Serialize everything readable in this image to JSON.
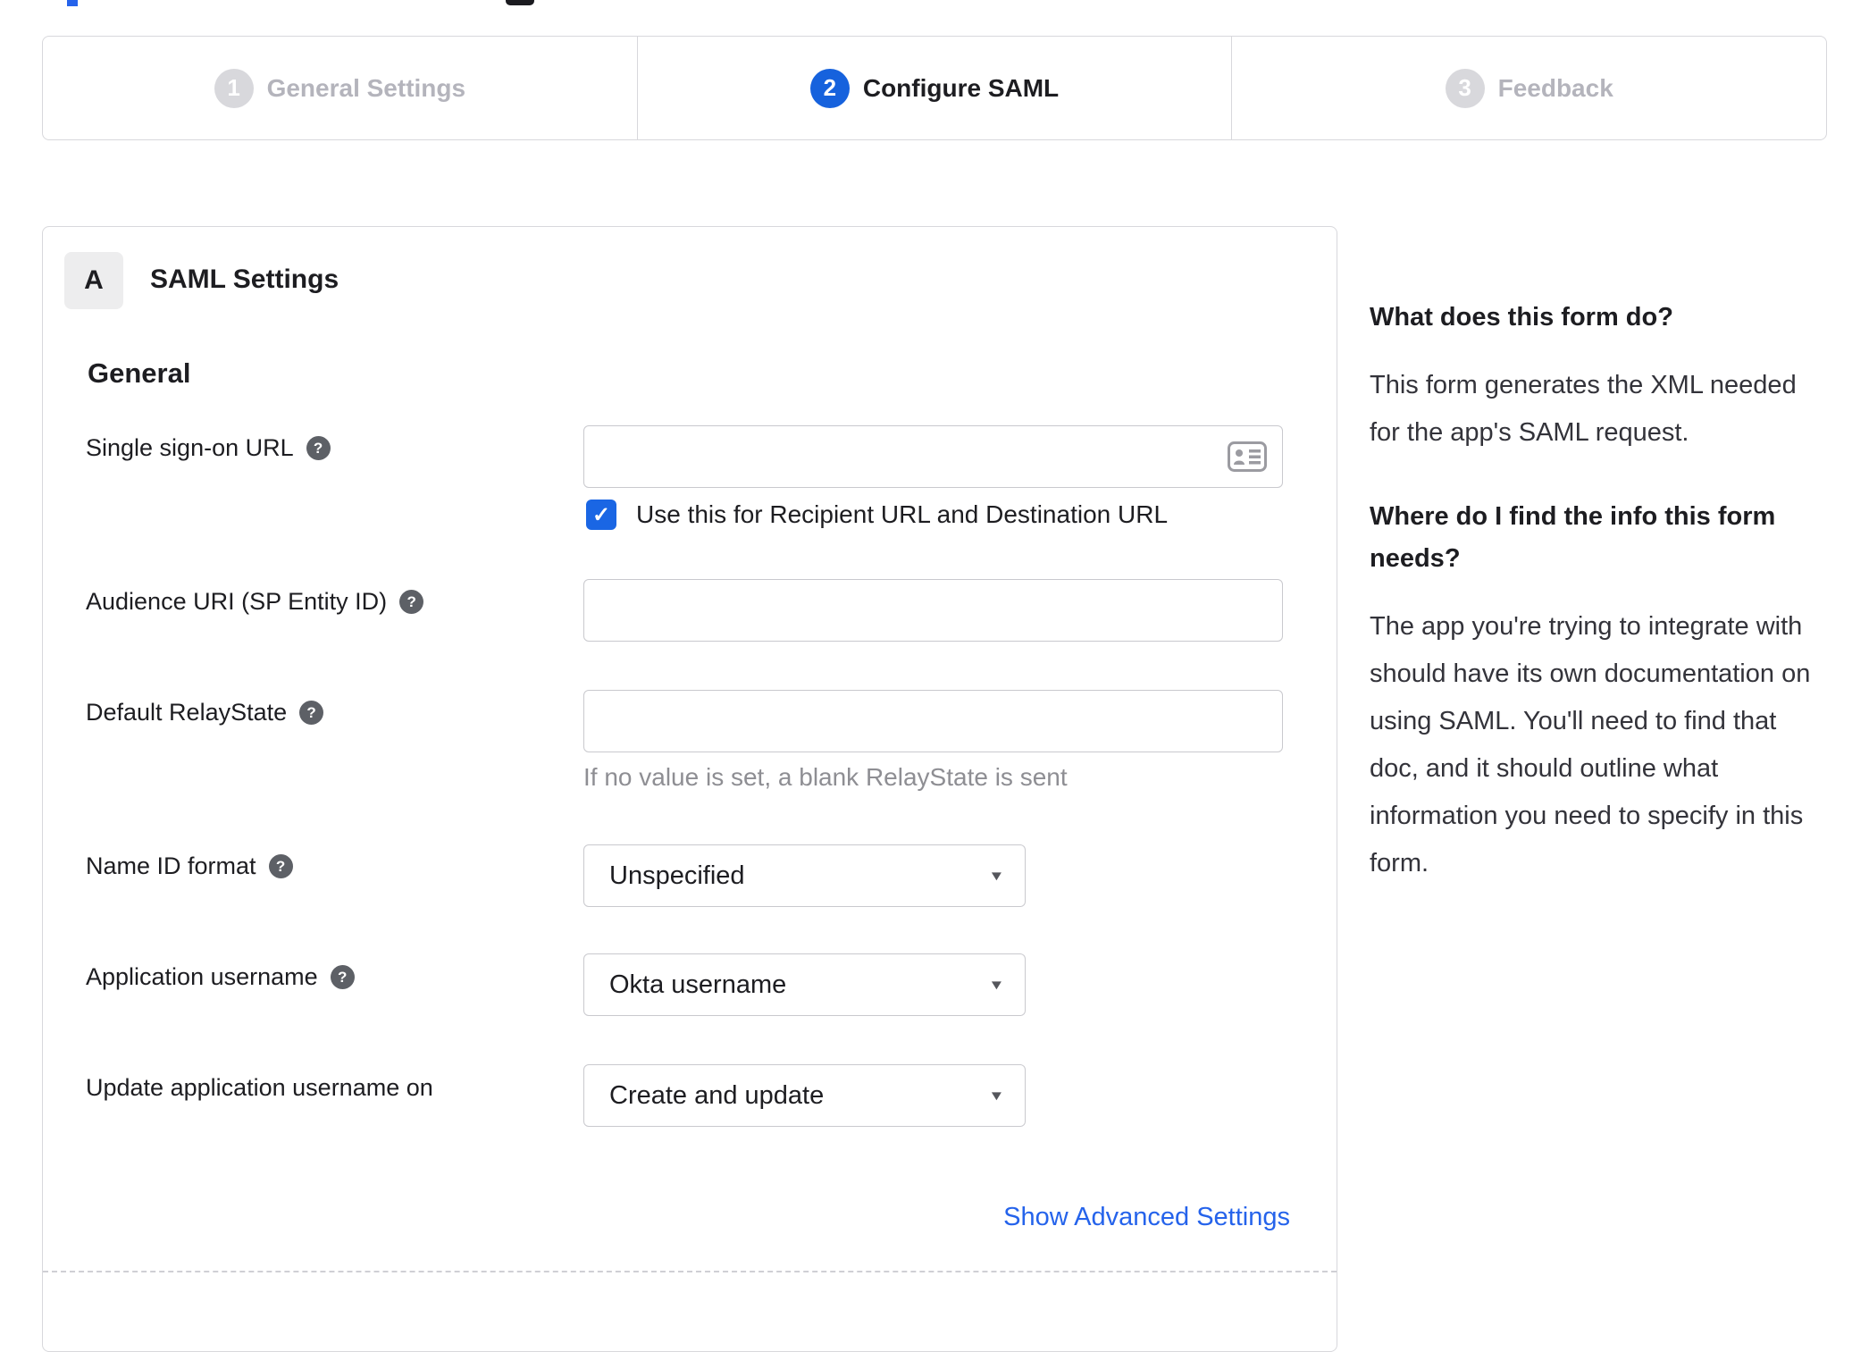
{
  "colors": {
    "accent_blue": "#1662dd",
    "link_blue": "#2563eb",
    "inactive_gray": "#d8d8dc"
  },
  "ui": {
    "help_glyph": "?",
    "check_glyph": "✓",
    "caret_glyph": "▼"
  },
  "stepper": {
    "steps": [
      {
        "number": "1",
        "label": "General Settings",
        "state": "inactive"
      },
      {
        "number": "2",
        "label": "Configure SAML",
        "state": "active"
      },
      {
        "number": "3",
        "label": "Feedback",
        "state": "inactive"
      }
    ]
  },
  "panel": {
    "section_badge": "A",
    "section_title": "SAML Settings",
    "group_heading": "General",
    "fields": [
      {
        "label": "Single sign-on URL",
        "type": "text",
        "value": "",
        "has_help": true
      },
      {
        "label": "Audience URI (SP Entity ID)",
        "type": "text",
        "value": "",
        "has_help": true
      },
      {
        "label": "Default RelayState",
        "type": "text",
        "value": "",
        "has_help": true,
        "hint": "If no value is set, a blank RelayState is sent"
      },
      {
        "label": "Name ID format",
        "type": "select",
        "value": "Unspecified",
        "has_help": true
      },
      {
        "label": "Application username",
        "type": "select",
        "value": "Okta username",
        "has_help": true
      },
      {
        "label": "Update application username on",
        "type": "select",
        "value": "Create and update",
        "has_help": false
      }
    ],
    "sso_checkbox": {
      "checked": true,
      "label": "Use this for Recipient URL and Destination URL"
    },
    "advanced_link_label": "Show Advanced Settings"
  },
  "sidebar": {
    "blocks": [
      {
        "heading": "What does this form do?",
        "body": "This form generates the XML needed for the app's SAML request."
      },
      {
        "heading": "Where do I find the info this form needs?",
        "body": "The app you're trying to integrate with should have its own documentation on using SAML. You'll need to find that doc, and it should outline what information you need to specify in this form."
      }
    ]
  }
}
